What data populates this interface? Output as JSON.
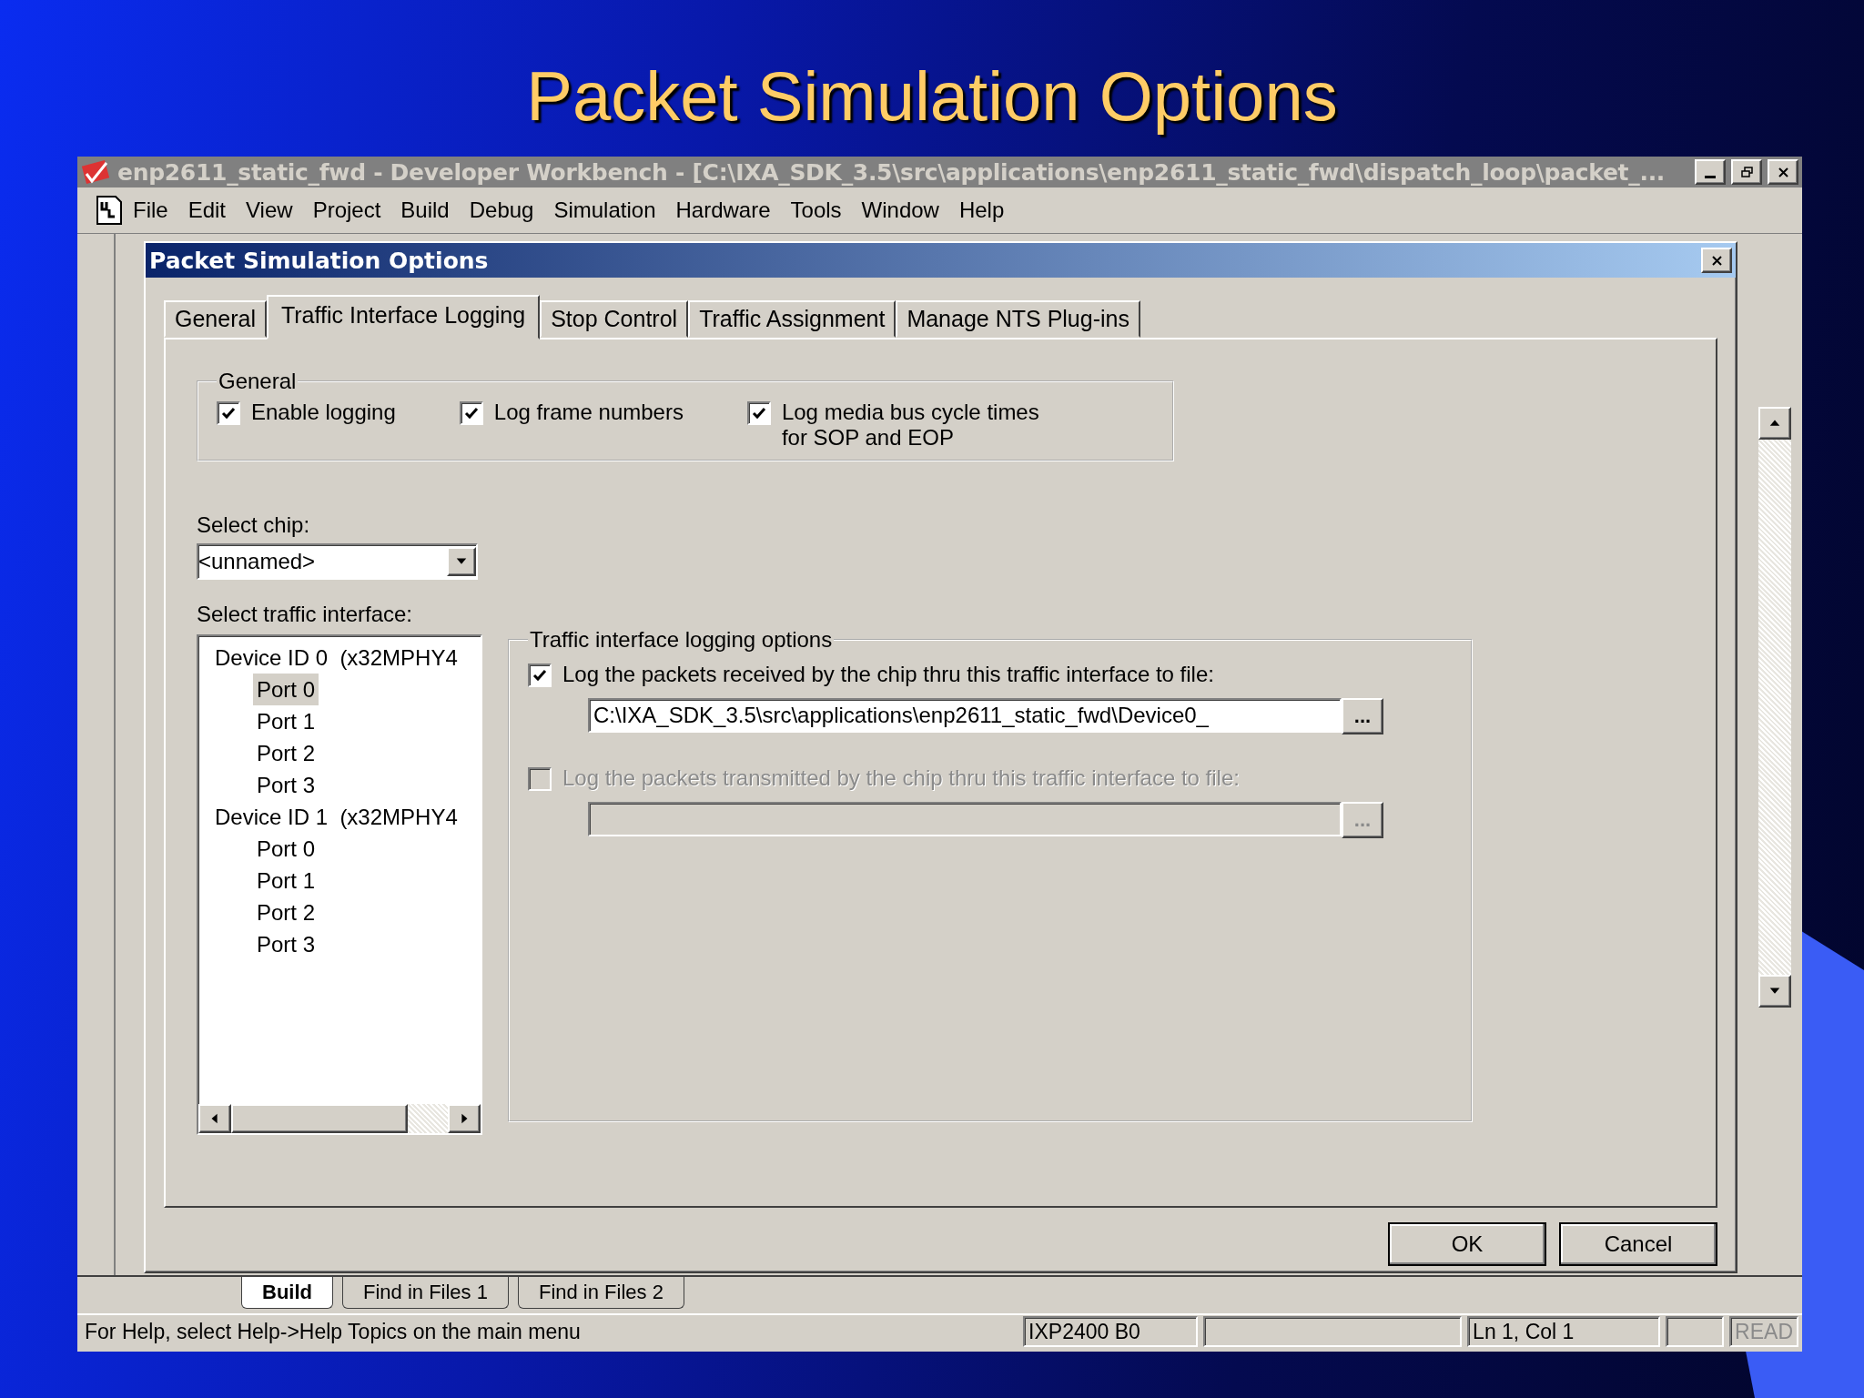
{
  "slide": {
    "title": "Packet Simulation Options"
  },
  "window": {
    "title": "enp2611_static_fwd - Developer Workbench - [C:\\IXA_SDK_3.5\\src\\applications\\enp2611_static_fwd\\dispatch_loop\\packet_..."
  },
  "menu": [
    "File",
    "Edit",
    "View",
    "Project",
    "Build",
    "Debug",
    "Simulation",
    "Hardware",
    "Tools",
    "Window",
    "Help"
  ],
  "dialog": {
    "title": "Packet Simulation Options",
    "tabs": [
      {
        "label": "General",
        "selected": false
      },
      {
        "label": "Traffic Interface Logging",
        "selected": true
      },
      {
        "label": "Stop Control",
        "selected": false
      },
      {
        "label": "Traffic Assignment",
        "selected": false
      },
      {
        "label": "Manage NTS Plug-ins",
        "selected": false
      }
    ],
    "general_group": {
      "title": "General",
      "options": [
        {
          "label": "Enable logging",
          "checked": true
        },
        {
          "label": "Log frame numbers",
          "checked": true
        },
        {
          "label": "Log media bus cycle times\nfor SOP and EOP",
          "checked": true
        }
      ]
    },
    "chip": {
      "label": "Select chip:",
      "value": "<unnamed>"
    },
    "interfaces": {
      "label": "Select traffic interface:",
      "items": [
        {
          "label": "Device ID 0  (x32MPHY4",
          "children": [
            {
              "label": "Port 0",
              "selected": true
            },
            {
              "label": "Port 1",
              "selected": false
            },
            {
              "label": "Port 2",
              "selected": false
            },
            {
              "label": "Port 3",
              "selected": false
            }
          ]
        },
        {
          "label": "Device ID 1  (x32MPHY4",
          "children": [
            {
              "label": "Port 0",
              "selected": false
            },
            {
              "label": "Port 1",
              "selected": false
            },
            {
              "label": "Port 2",
              "selected": false
            },
            {
              "label": "Port 3",
              "selected": false
            }
          ]
        }
      ]
    },
    "logging_options": {
      "title": "Traffic interface logging options",
      "rows": [
        {
          "label": "Log the packets received by the chip thru this traffic interface to file:",
          "checked": true,
          "disabled": false,
          "path": "C:\\IXA_SDK_3.5\\src\\applications\\enp2611_static_fwd\\Device0_",
          "browse": "..."
        },
        {
          "label": "Log the packets transmitted by the chip thru this traffic interface to file:",
          "checked": false,
          "disabled": true,
          "browse": "..."
        }
      ]
    },
    "buttons": [
      "OK",
      "Cancel"
    ]
  },
  "output_tabs": [
    {
      "label": "Build",
      "selected": true
    },
    {
      "label": "Find in Files 1",
      "selected": false
    },
    {
      "label": "Find in Files 2",
      "selected": false
    }
  ],
  "status_bar": [
    {
      "text": "For Help, select Help->Help Topics on the main menu",
      "disabled": false
    },
    {
      "text": "IXP2400 B0",
      "disabled": false
    },
    {
      "text": "Ln 1, Col 1",
      "disabled": false
    },
    {
      "text": "READ",
      "disabled": true
    }
  ]
}
